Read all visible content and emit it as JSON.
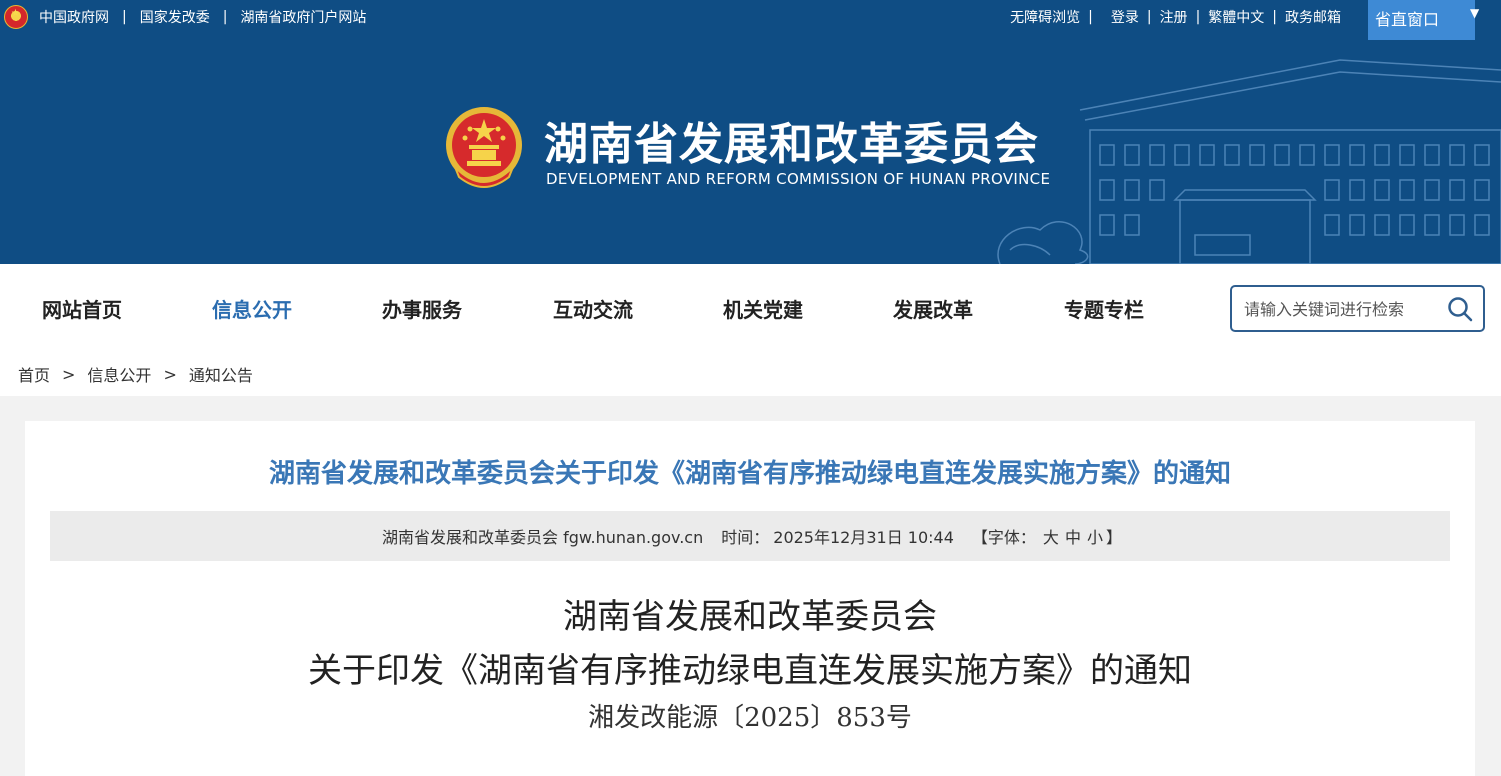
{
  "topbar": {
    "left_links": [
      "中国政府网",
      "国家发改委",
      "湖南省政府门户网站"
    ],
    "right_links": [
      "无障碍浏览",
      "登录",
      "注册",
      "繁體中文",
      "政务邮箱"
    ],
    "window_button": "省直窗口"
  },
  "header": {
    "title_cn": "湖南省发展和改革委员会",
    "title_en": "DEVELOPMENT AND REFORM COMMISSION OF HUNAN PROVINCE"
  },
  "nav": {
    "items": [
      "网站首页",
      "信息公开",
      "办事服务",
      "互动交流",
      "机关党建",
      "发展改革",
      "专题专栏"
    ],
    "active": "信息公开"
  },
  "search": {
    "placeholder": "请输入关键词进行检索"
  },
  "breadcrumb": [
    "首页",
    "信息公开",
    "通知公告"
  ],
  "breadcrumb_separator": ">",
  "article": {
    "title": "湖南省发展和改革委员会关于印发《湖南省有序推动绿电直连发展实施方案》的通知",
    "source": "湖南省发展和改革委员会 fgw.hunan.gov.cn",
    "time_label": "时间：",
    "time": "2025年12月31日 10:44",
    "font_label": "【字体：",
    "font_large": "大",
    "font_medium": "中",
    "font_small": "小",
    "font_close": "】",
    "doc_line1": "湖南省发展和改革委员会",
    "doc_line2": "关于印发《湖南省有序推动绿电直连发展实施方案》的通知",
    "doc_number": "湘发改能源〔2025〕853号"
  },
  "colors": {
    "header_bg": "#0f4d84",
    "nav_active": "#2b6db0",
    "title_blue": "#3a77b6",
    "window_button_bg": "#3e8ad5"
  }
}
